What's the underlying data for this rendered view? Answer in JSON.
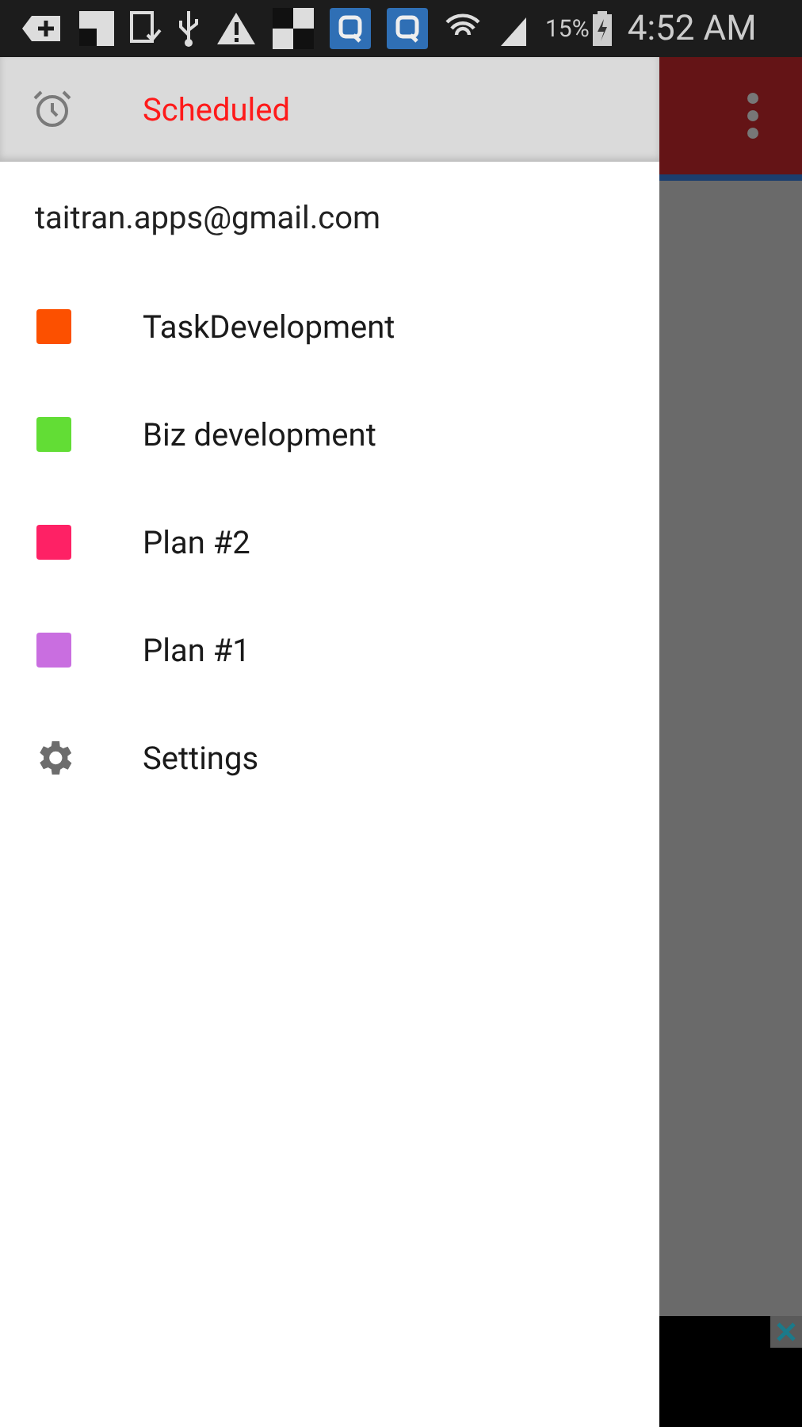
{
  "status_bar": {
    "battery": "15%",
    "time": "4:52 AM"
  },
  "drawer": {
    "account": "taitran.apps@gmail.com",
    "items": [
      {
        "kind": "scheduled",
        "label": "Scheduled",
        "selected": true
      },
      {
        "kind": "project",
        "label": "TaskDevelopment",
        "color": "#fc5000",
        "selected": false
      },
      {
        "kind": "project",
        "label": "Biz development",
        "color": "#62dd35",
        "selected": false
      },
      {
        "kind": "project",
        "label": "Plan #2",
        "color": "#fe2165",
        "selected": false
      },
      {
        "kind": "project",
        "label": "Plan #1",
        "color": "#c96ee0",
        "selected": false
      },
      {
        "kind": "settings",
        "label": "Settings",
        "selected": false
      }
    ]
  }
}
